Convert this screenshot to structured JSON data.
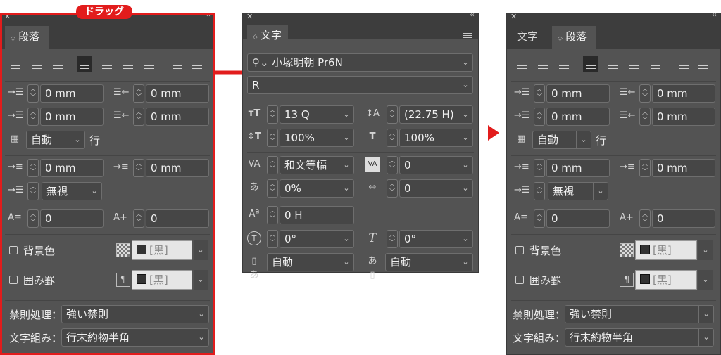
{
  "annotation": {
    "drag_label": "ドラッグ",
    "accent": "#e21c1c"
  },
  "left": {
    "tab": "段落",
    "indent": {
      "left": "0 mm",
      "right": "0 mm",
      "first": "0 mm",
      "last": "0 mm"
    },
    "grid": {
      "value": "自動",
      "unit": "行"
    },
    "space": {
      "before": "0 mm",
      "after": "0 mm"
    },
    "grid_align": "無視",
    "drop": {
      "lines": "0",
      "chars": "0"
    },
    "shading": {
      "label": "背景色",
      "color": "[黒]"
    },
    "border": {
      "label": "囲み罫",
      "color": "[黒]"
    },
    "kinsoku": {
      "label": "禁則処理：",
      "value": "強い禁則"
    },
    "mojikumi": {
      "label": "文字組み：",
      "value": "行末約物半角"
    }
  },
  "mid": {
    "tab": "文字",
    "font": "小塚明朝 Pr6N",
    "style": "R",
    "size": "13 Q",
    "leading": "(22.75 H)",
    "vscale": "100%",
    "hscale": "100%",
    "kerning": "和文等幅",
    "tracking": "0",
    "tsume": "0%",
    "aki": "0",
    "baseline": "0 H",
    "rotate": "0°",
    "skew": "0°",
    "before": "自動",
    "after": "自動"
  },
  "right": {
    "tabs": [
      "文字",
      "段落"
    ],
    "indent": {
      "left": "0 mm",
      "right": "0 mm",
      "first": "0 mm",
      "last": "0 mm"
    },
    "grid": {
      "value": "自動",
      "unit": "行"
    },
    "space": {
      "before": "0 mm",
      "after": "0 mm"
    },
    "grid_align": "無視",
    "drop": {
      "lines": "0",
      "chars": "0"
    },
    "shading": {
      "label": "背景色",
      "color": "[黒]"
    },
    "border": {
      "label": "囲み罫",
      "color": "[黒]"
    },
    "kinsoku": {
      "label": "禁則処理：",
      "value": "強い禁則"
    },
    "mojikumi": {
      "label": "文字組み：",
      "value": "行末約物半角"
    }
  }
}
